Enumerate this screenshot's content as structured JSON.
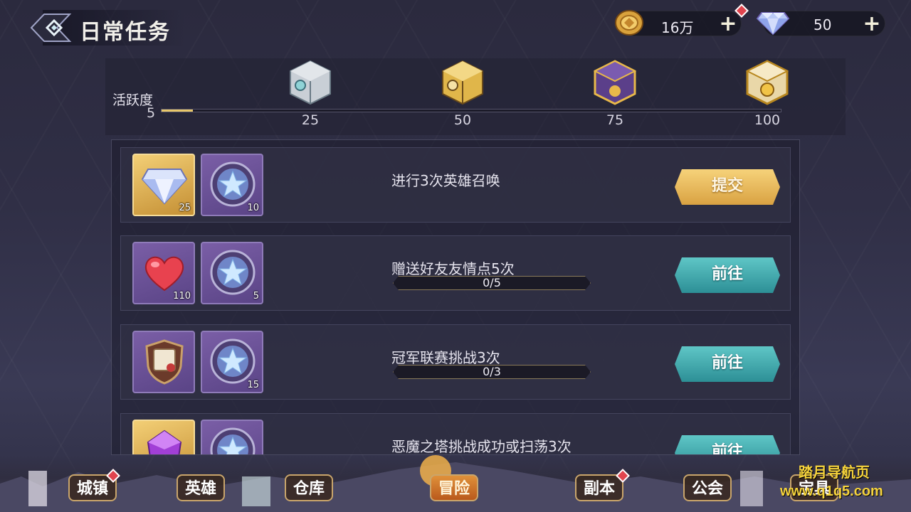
{
  "header": {
    "title": "日常任务",
    "gold": {
      "value": "16万"
    },
    "diamond": {
      "value": "50"
    }
  },
  "activity": {
    "label": "活跃度",
    "current": "5",
    "progress_fraction": 0.05,
    "milestones": [
      "25",
      "50",
      "75",
      "100"
    ]
  },
  "tasks": [
    {
      "text": "进行3次英雄召唤",
      "rewards": [
        {
          "icon": "diamond-icon",
          "qty": "25"
        },
        {
          "icon": "star-medal-icon",
          "qty": "10"
        }
      ],
      "button": "提交",
      "button_type": "submit"
    },
    {
      "text": "赠送好友友情点5次",
      "progress": "0/5",
      "rewards": [
        {
          "icon": "heart-icon",
          "qty": "110"
        },
        {
          "icon": "star-medal-icon",
          "qty": "5"
        }
      ],
      "button": "前往",
      "button_type": "go"
    },
    {
      "text": "冠军联赛挑战3次",
      "progress": "0/3",
      "rewards": [
        {
          "icon": "scroll-shield-icon",
          "qty": ""
        },
        {
          "icon": "star-medal-icon",
          "qty": "15"
        }
      ],
      "button": "前往",
      "button_type": "go"
    },
    {
      "text": "恶魔之塔挑战成功或扫荡3次",
      "rewards": [
        {
          "icon": "purple-gem-icon",
          "qty": ""
        },
        {
          "icon": "star-medal-icon",
          "qty": ""
        }
      ],
      "button": "前往",
      "button_type": "go"
    }
  ],
  "nav": {
    "items": [
      "城镇",
      "英雄",
      "仓库",
      "冒险",
      "副本",
      "公会",
      "宝具"
    ],
    "active": "冒险"
  },
  "watermark": {
    "site": "踏月导航页",
    "url": "www.q1q5.com"
  },
  "colors": {
    "submit": "#e2b24f",
    "go": "#3fa7ab",
    "accent_gold": "#e8c76a",
    "badge_red": "#e1444e"
  }
}
